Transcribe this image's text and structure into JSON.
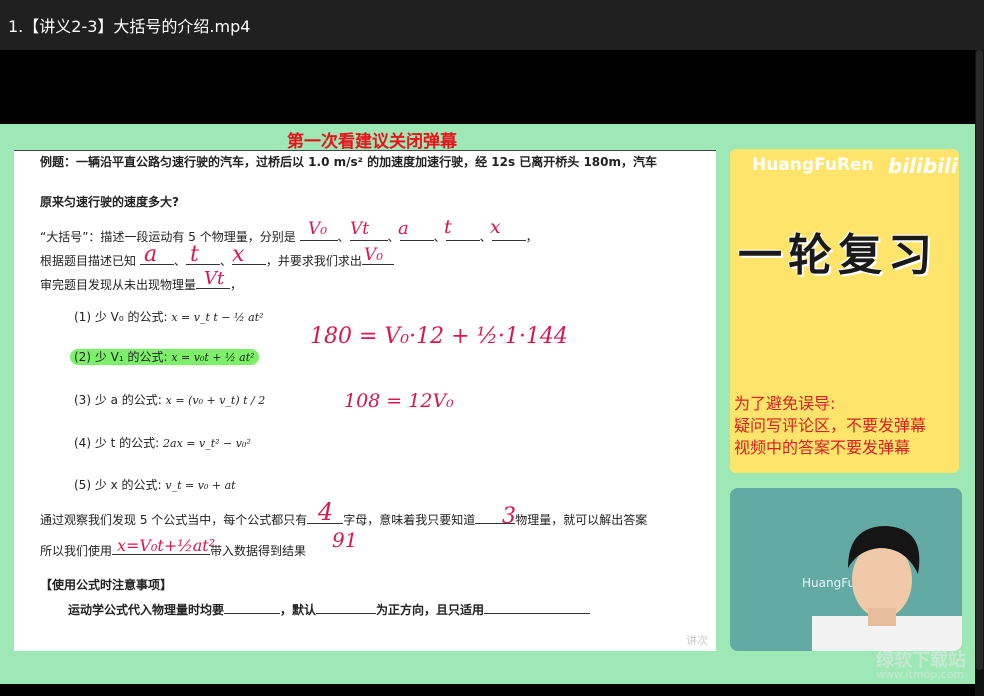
{
  "window": {
    "title": "1.【讲义2-3】大括号的介绍.mp4"
  },
  "video": {
    "warning": "第一次看建议关闭弹幕",
    "doc": {
      "example": "例题：一辆沿平直公路匀速行驶的汽车，过桥后以 1.0 m/s² 的加速度加速行驶，经 12s 已离开桥头 180m，汽车",
      "question": "原来匀速行驶的速度多大?",
      "line1_prefix": "“大括号”：描述一段运动有 5 个物理量，分别是",
      "line2_prefix": "根据题目描述已知",
      "line2_suffix": "，并要求我们求出",
      "line3_prefix": "审完题目发现从未出现物理量",
      "f1_label": "(1) 少 V₀ 的公式:",
      "f1": "x = v_t t − ½ at²",
      "f2_label": "(2) 少 V₁ 的公式:",
      "f2": "x = v₀t + ½ at²",
      "f3_label": "(3) 少 a 的公式:",
      "f3": "x = (v₀ + v_t) t / 2",
      "f4_label": "(4) 少 t 的公式:",
      "f4": "2ax = v_t² − v₀²",
      "f5_label": "(5) 少 x 的公式:",
      "f5": "v_t = v₀ + at",
      "obs_a": "通过观察我们发现 5 个公式当中，每个公式都只有",
      "obs_b": "字母，意味着我只要知道",
      "obs_c": "物理量，就可以解出答案",
      "use_a": "所以我们使用",
      "use_b": "带入数据得到结果",
      "notes_title": "【使用公式时注意事项】",
      "notes_a": "运动学公式代入物理量时均要",
      "notes_b": "，默认",
      "notes_c": "为正方向，且只适用"
    },
    "handwriting": {
      "q1": "V₀",
      "q2": "Vt",
      "q3": "a",
      "q4": "t",
      "q5": "x",
      "k1": "a",
      "k2": "t",
      "k3": "x",
      "find": "V₀",
      "missing": "Vt",
      "eq1": "180 = V₀·12 + ½·1·144",
      "eq2": "108 = 12V₀",
      "four": "4",
      "ninety_one": "91",
      "three": "3",
      "chosen": "x=V₀t+½at²"
    },
    "card": {
      "brand": "HuangFuRen",
      "bili": "bilibili",
      "big": "一轮复习",
      "notice1": "为了避免误导:",
      "notice2": "疑问写评论区，不要发弹幕",
      "notice3": "视频中的答案不要发弹幕"
    },
    "cam_tag": "HuangFu",
    "doc_corner": "讲次",
    "watermark1": "绿软下载站",
    "watermark2": "www.itmop.com"
  }
}
